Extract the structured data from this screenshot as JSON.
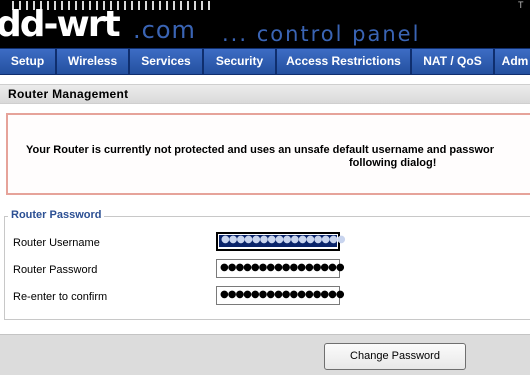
{
  "header": {
    "logo_main": "dd-wrt",
    "logo_domain": ".com",
    "logo_tagline": "... control panel",
    "corner_text": "T"
  },
  "nav": {
    "tabs": [
      {
        "label": "Setup"
      },
      {
        "label": "Wireless"
      },
      {
        "label": "Services"
      },
      {
        "label": "Security"
      },
      {
        "label": "Access Restrictions"
      },
      {
        "label": "NAT / QoS"
      },
      {
        "label": "Adm"
      }
    ]
  },
  "section": {
    "title": "Router Management"
  },
  "warning": {
    "line1": "Your Router is currently not protected and uses an unsafe default username and passwor",
    "line2": "following dialog!"
  },
  "router_password": {
    "legend": "Router Password",
    "fields": [
      {
        "label": "Router Username",
        "value": "●●●●●●●●●●●●●●●●"
      },
      {
        "label": "Router Password",
        "value": "●●●●●●●●●●●●●●●●"
      },
      {
        "label": "Re-enter to confirm",
        "value": "●●●●●●●●●●●●●●●●"
      }
    ]
  },
  "footer": {
    "change_button": "Change Password"
  },
  "colors": {
    "nav_tab": "#2f5db3",
    "brand_blue": "#3a64b4",
    "warning_border": "#e6a39a",
    "legend_text": "#2b4f93"
  }
}
